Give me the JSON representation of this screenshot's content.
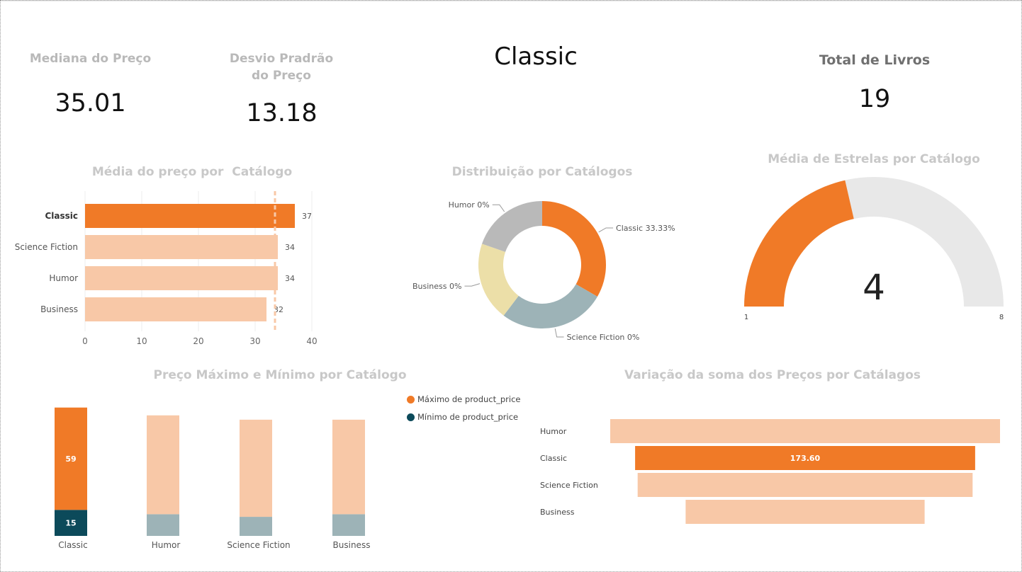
{
  "header": {
    "median_label": "Mediana do Preço",
    "median_value": "35.01",
    "stddev_label": "Desvio Pradrão do Preço",
    "stddev_value": "13.18",
    "selected_catalog": "Classic",
    "total_label": "Total de Livros",
    "total_value": "19"
  },
  "colors": {
    "orange": "#f07a27",
    "light_orange": "#f8c8a7",
    "teal_dark": "#0c4a5a",
    "teal_light": "#9db3b7",
    "yellow_light": "#ecdfa8",
    "gray": "#b9b9b9",
    "gauge_bg": "#e8e8e8"
  },
  "chart_data": [
    {
      "id": "avg_price",
      "type": "bar",
      "orientation": "horizontal",
      "title": "Média do preço por  Catálogo",
      "categories": [
        "Classic",
        "Science Fiction",
        "Humor",
        "Business"
      ],
      "values": [
        37,
        34,
        34,
        32
      ],
      "data_labels": [
        "37",
        "34",
        "34",
        "32"
      ],
      "highlight": "Classic",
      "xlim": [
        0,
        40
      ],
      "xticks": [
        "0",
        "10",
        "20",
        "30",
        "40"
      ],
      "reference_line": 33.5,
      "grid": true
    },
    {
      "id": "distribution",
      "type": "pie",
      "title": "Distribuição por Catálogos",
      "donut": true,
      "categories": [
        "Classic",
        "Science Fiction",
        "Business",
        "Humor"
      ],
      "values": [
        33.33,
        27,
        20,
        19.67
      ],
      "labels": [
        "Classic 33.33%",
        "Science Fiction 0%",
        "Business 0%",
        "Humor 0%"
      ]
    },
    {
      "id": "avg_stars",
      "type": "gauge",
      "title": "Média de Estrelas por Catálogo",
      "value": 4,
      "value_label": "4",
      "min": 1,
      "max": 8,
      "min_label": "1",
      "max_label": "8"
    },
    {
      "id": "max_min",
      "type": "bar",
      "stacked": true,
      "title": "Preço Máximo e Mínimo por Catálogo",
      "categories": [
        "Classic",
        "Humor",
        "Science Fiction",
        "Business"
      ],
      "series": [
        {
          "name": "Mínimo de product_price",
          "values": [
            15,
            12.5,
            11,
            12.5
          ],
          "labels": [
            "15",
            "",
            "",
            ""
          ]
        },
        {
          "name": "Máximo de product_price",
          "values": [
            59,
            57,
            56,
            54.5
          ],
          "labels": [
            "59",
            "",
            "",
            ""
          ]
        }
      ],
      "highlight": "Classic",
      "legend": "top-right"
    },
    {
      "id": "sum_variation",
      "type": "bar",
      "funnel": true,
      "title": "Variação da soma dos Preços por Catálagos",
      "categories": [
        "Humor",
        "Classic",
        "Science Fiction",
        "Business"
      ],
      "values": [
        199,
        173.6,
        171,
        122
      ],
      "data_labels": [
        "",
        "173.60",
        "",
        ""
      ],
      "highlight": "Classic"
    }
  ]
}
